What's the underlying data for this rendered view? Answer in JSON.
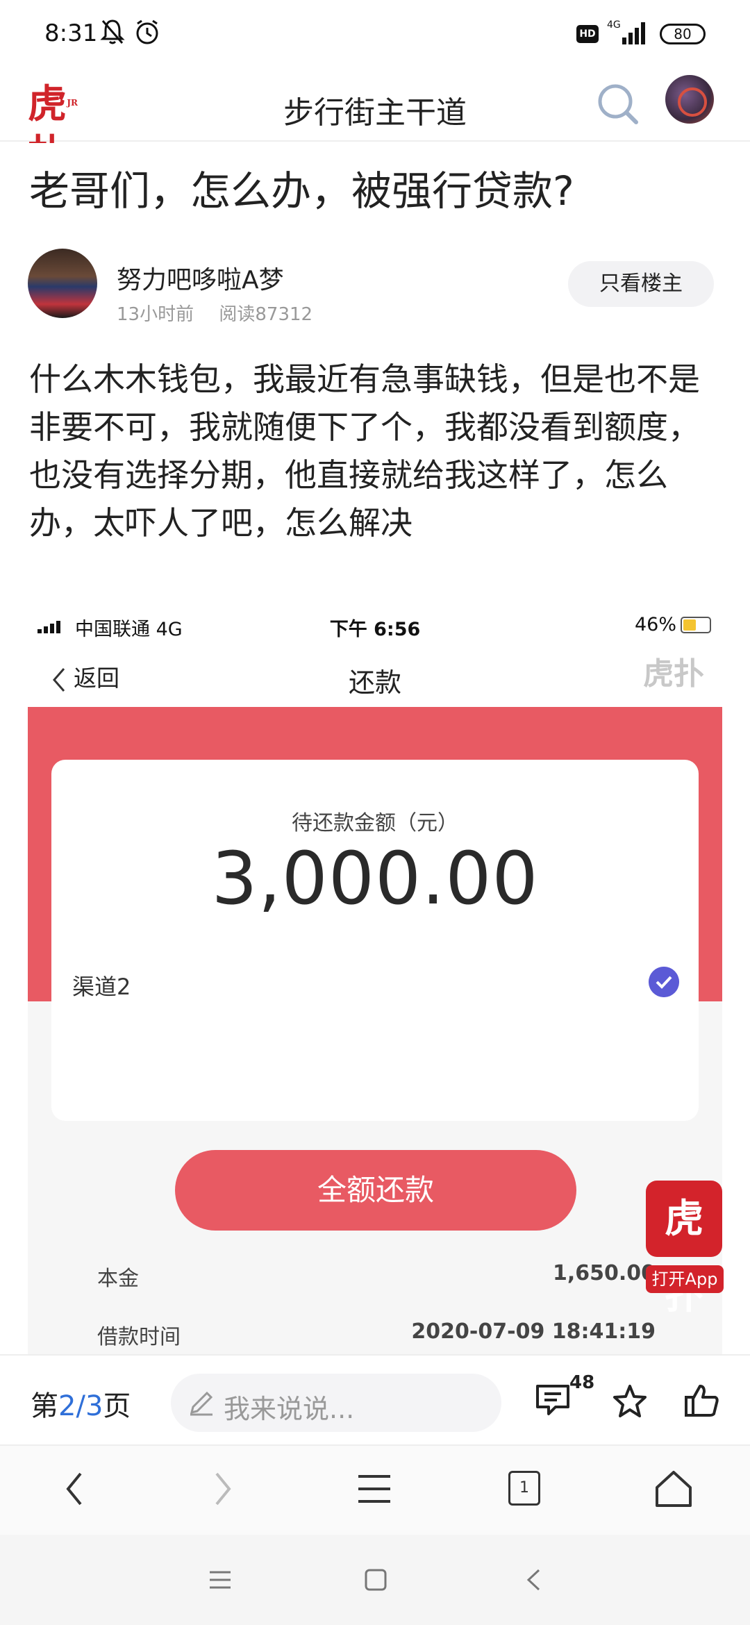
{
  "status_bar": {
    "time": "8:31",
    "net": "4G",
    "hd": "HD",
    "battery": "80"
  },
  "header": {
    "title": "步行街主干道",
    "logo_text": "虎扑",
    "logo_small": "JR"
  },
  "post": {
    "title": "老哥们，怎么办，被强行贷款?",
    "author": "努力吧哆啦A梦",
    "time": "13小时前",
    "reads": "阅读87312",
    "only_op_label": "只看楼主",
    "body": "什么木木钱包，我最近有急事缺钱，但是也不是非要不可，我就随便下了个，我都没看到额度，也没有选择分期，他直接就给我这样了，怎么办，太吓人了吧，怎么解决"
  },
  "embedded": {
    "carrier": "中国联通  4G",
    "time": "下午 6:56",
    "battery": "46%",
    "back_label": "返回",
    "title": "还款",
    "watermark": "虎扑",
    "amount_label": "待还款金额（元）",
    "amount": "3,000.00",
    "channel": "渠道2",
    "button": "全额还款",
    "rows": [
      {
        "label": "本金",
        "value": "1,650.00"
      },
      {
        "label": "借款时间",
        "value": "2020-07-09 18:41:19"
      }
    ]
  },
  "app_badge": {
    "logo": "虎扑",
    "open_label": "打开App"
  },
  "toolbar": {
    "page_prefix": "第",
    "page_current": "2",
    "page_sep": "/",
    "page_total": "3",
    "page_suffix": "页",
    "reply_placeholder": "我来说说...",
    "comment_count": "48"
  },
  "browser_nav": {
    "tab_count": "1"
  },
  "colors": {
    "brand_red": "#d3232b",
    "embed_red": "#e85a63",
    "link_blue": "#2f6fd8",
    "check_purple": "#5b5ad6"
  }
}
